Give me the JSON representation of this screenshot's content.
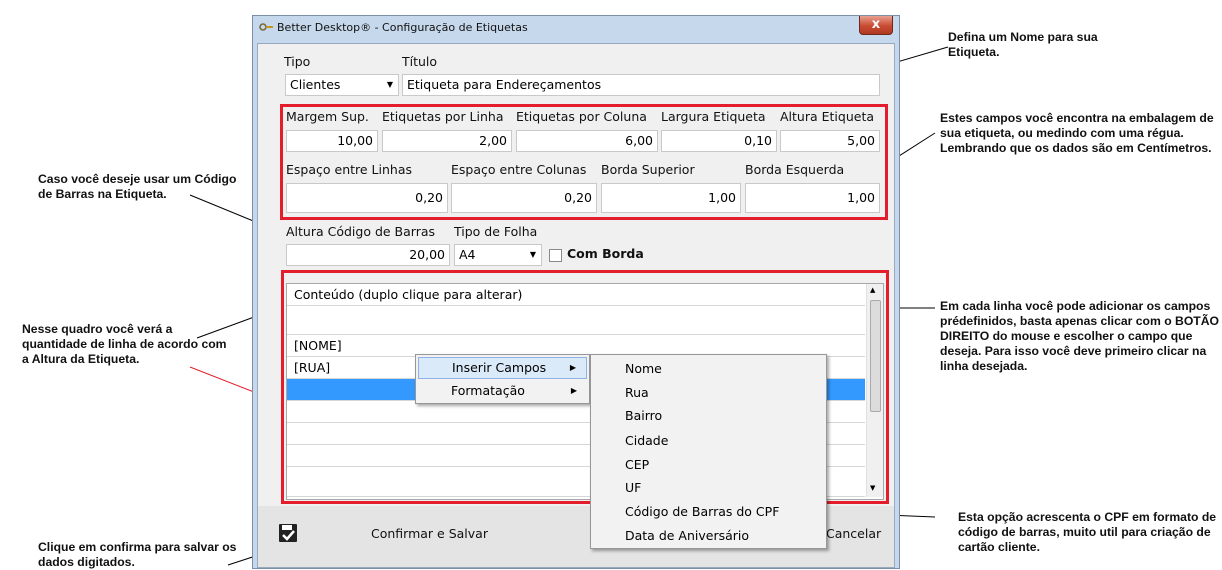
{
  "window": {
    "title": "Better Desktop® - Configuração de Etiquetas",
    "close_glyph": "x"
  },
  "labels": {
    "tipo": "Tipo",
    "titulo": "Título",
    "margem_sup": "Margem Sup.",
    "etiq_linha": "Etiquetas por Linha",
    "etiq_coluna": "Etiquetas por Coluna",
    "largura": "Largura Etiqueta",
    "altura": "Altura Etiqueta",
    "esp_linhas": "Espaço entre Linhas",
    "esp_colunas": "Espaço entre Colunas",
    "borda_sup": "Borda Superior",
    "borda_esq": "Borda Esquerda",
    "altura_cod": "Altura Código de Barras",
    "tipo_folha": "Tipo de Folha",
    "com_borda": "Com Borda"
  },
  "values": {
    "tipo": "Clientes",
    "titulo": "Etiqueta para Endereçamentos",
    "margem_sup": "10,00",
    "etiq_linha": "2,00",
    "etiq_coluna": "6,00",
    "largura": "0,10",
    "altura": "5,00",
    "esp_linhas": "0,20",
    "esp_colunas": "0,20",
    "borda_sup": "1,00",
    "borda_esq": "1,00",
    "altura_cod": "20,00",
    "tipo_folha": "A4",
    "com_borda": false
  },
  "grid": {
    "header": "Conteúdo (duplo clique para alterar)",
    "rows": [
      "",
      "[NOME]",
      "[RUA]",
      "",
      "",
      "",
      "",
      ""
    ],
    "selected_row": 3
  },
  "context_menu": {
    "items": [
      "Inserir Campos",
      "Formatação"
    ],
    "active": "Inserir Campos"
  },
  "submenu": {
    "items": [
      "Nome",
      "Rua",
      "Bairro",
      "Cidade",
      "CEP",
      "UF",
      "Código de Barras do CPF",
      "Data de Aniversário"
    ],
    "highlight": "Código de Barras do CPF"
  },
  "footer": {
    "confirm": "Confirmar e Salvar",
    "cancel": "Cancelar",
    "save_icon": "save-check-icon"
  },
  "annotations": {
    "nome": "Defina um Nome para sua Etiqueta.",
    "medidas": "Estes campos você encontra na embalagem de sua etiqueta, ou medindo com uma régua. Lembrando que os dados são em Centímetros.",
    "codbarras": "Caso você deseje usar um Código de Barras na Etiqueta.",
    "quadro": "Nesse quadro você verá a quantidade de linha de acordo com a Altura da Etiqueta.",
    "linhas": "Em cada linha você pode adicionar os campos prédefinidos, basta apenas clicar com o BOTÃO DIREITO do mouse e escolher o campo que deseja. Para isso você deve primeiro clicar na linha desejada.",
    "cpf": "Esta opção acrescenta o CPF em formato de código de barras, muito util para criação de cartão cliente.",
    "confirma": "Clique em confirma para salvar os dados digitados."
  },
  "colors": {
    "highlight_box": "#e31d2b",
    "selection": "#3399ff",
    "window_frame": "#c6d8ec"
  }
}
